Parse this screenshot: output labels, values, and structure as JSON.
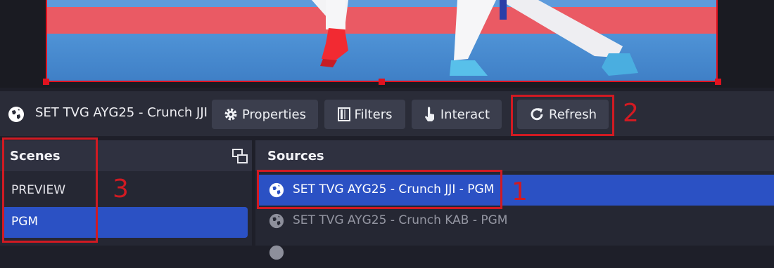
{
  "toolbar": {
    "source_name": "SET TVG AYG25 - Crunch JJI",
    "properties_label": "Properties",
    "filters_label": "Filters",
    "interact_label": "Interact",
    "refresh_label": "Refresh"
  },
  "scenes": {
    "title": "Scenes",
    "items": [
      {
        "label": "PREVIEW"
      },
      {
        "label": "PGM"
      }
    ]
  },
  "sources": {
    "title": "Sources",
    "items": [
      {
        "label": "SET TVG AYG25 - Crunch JJI - PGM"
      },
      {
        "label": "SET TVG AYG25 - Crunch KAB - PGM"
      }
    ]
  },
  "annotations": {
    "one": "1",
    "two": "2",
    "three": "3",
    "color": "#d11a22"
  },
  "colors": {
    "accent": "#2b51c4",
    "selection_border": "#e0121f"
  }
}
